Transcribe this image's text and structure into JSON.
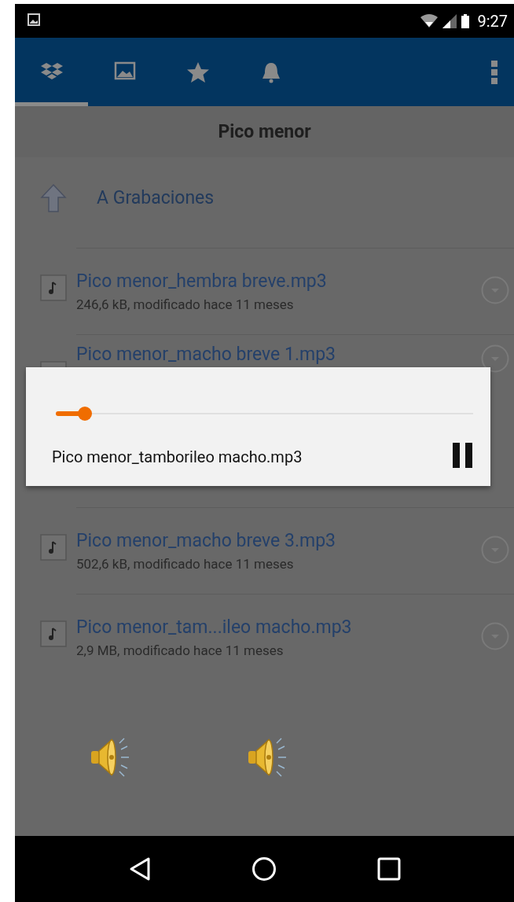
{
  "status_bar": {
    "time": "9:27"
  },
  "tabs": [
    {
      "kind": "dropbox",
      "selected": true
    },
    {
      "kind": "photos",
      "selected": false
    },
    {
      "kind": "favorites",
      "selected": false
    },
    {
      "kind": "notifications",
      "selected": false
    }
  ],
  "header": {
    "title": "Pico menor"
  },
  "up_item": {
    "label": "A Grabaciones"
  },
  "files": [
    {
      "name": "Pico menor_hembra breve.mp3",
      "details": "246,6 kB, modificado hace 11 meses"
    },
    {
      "name": "Pico menor_macho breve 1.mp3"
    },
    {
      "name": "Pico menor_macho breve 3.mp3",
      "details": "502,6 kB, modificado hace 11 meses"
    },
    {
      "name": "Pico menor_tam...ileo macho.mp3",
      "details": "2,9 MB, modificado hace 11 meses"
    }
  ],
  "player": {
    "level": 0.07,
    "filename": "Pico menor_tamborileo macho.mp3",
    "playing": true
  },
  "speakers": [
    {
      "kind": "speaker"
    },
    {
      "kind": "speaker"
    }
  ]
}
